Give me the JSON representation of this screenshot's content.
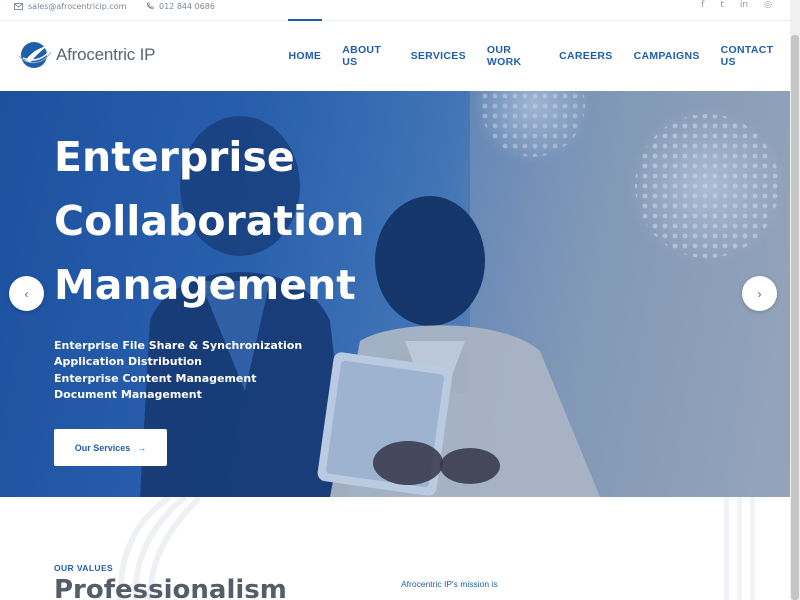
{
  "topbar": {
    "email": "sales@afrocentricip.com",
    "phone": "012 844 0686",
    "social": [
      {
        "icon": "facebook-icon",
        "glyph": "f"
      },
      {
        "icon": "twitter-icon",
        "glyph": "t"
      },
      {
        "icon": "linkedin-icon",
        "glyph": "in"
      },
      {
        "icon": "instagram-icon",
        "glyph": "◎"
      }
    ]
  },
  "header": {
    "logo_text": "Afrocentric IP",
    "nav": [
      "HOME",
      "ABOUT US",
      "SERVICES",
      "OUR WORK",
      "CAREERS",
      "CAMPAIGNS",
      "CONTACT US"
    ],
    "active_nav": "HOME"
  },
  "hero": {
    "title_lines": [
      "Enterprise",
      "Collaboration",
      "Management"
    ],
    "services": [
      "Enterprise File Share & Synchronization",
      "Application Distribution",
      "Enterprise Content Management",
      "Document Management"
    ],
    "cta_label": "Our Services",
    "cta_arrow": "→",
    "prev_arrow": "‹",
    "next_arrow": "›"
  },
  "values": {
    "eyebrow": "OUR VALUES",
    "heading": "Professionalism",
    "mission_text": "Afrocentric IP's mission is"
  },
  "colors": {
    "brand_blue": "#1f5faa",
    "hero_overlay": "#2b62ae",
    "text_dark": "#555e68"
  }
}
